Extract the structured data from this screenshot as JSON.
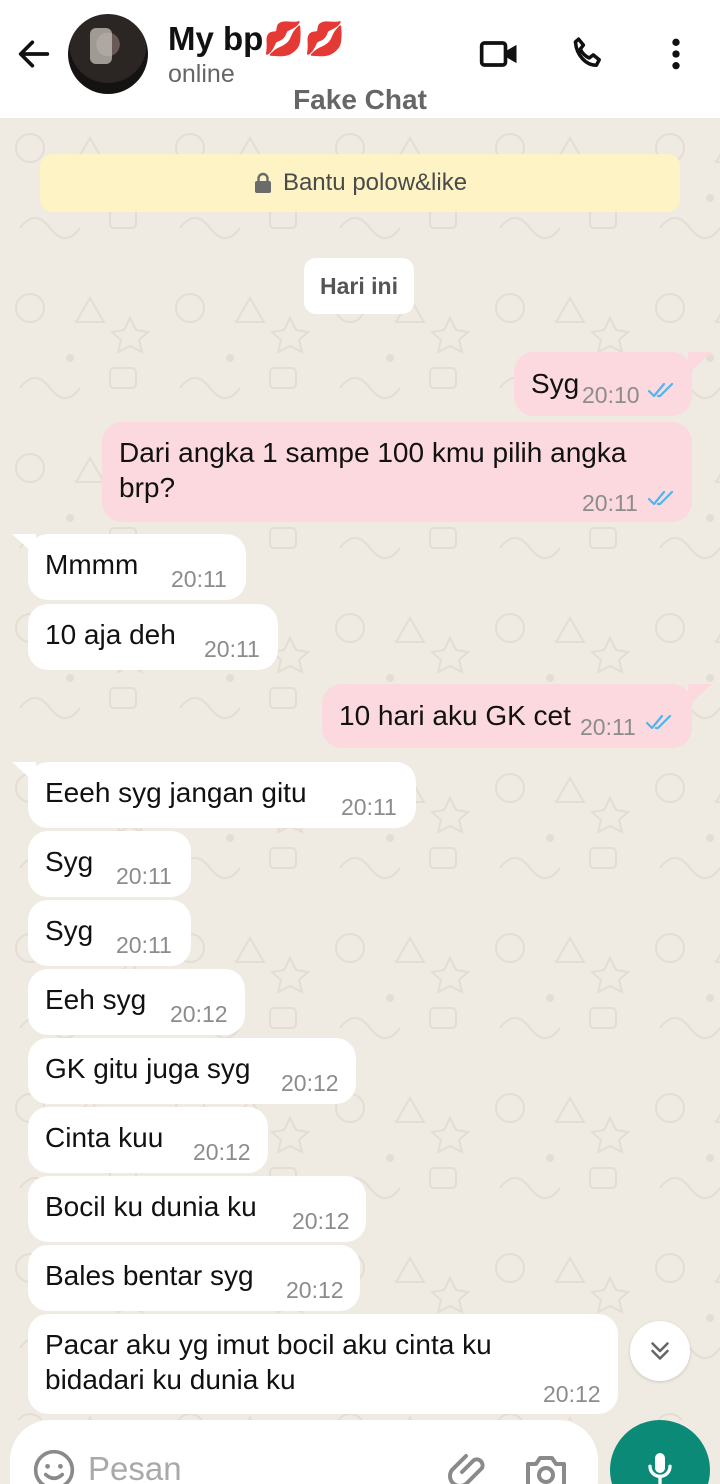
{
  "header": {
    "contact_name": "My bp💋💋",
    "status": "online",
    "title": "Fake Chat"
  },
  "notice": {
    "text": "Bantu polow&like"
  },
  "date_chip": "Hari ini",
  "messages": [
    {
      "dir": "out",
      "text": "Syg",
      "time": "20:10",
      "read": true
    },
    {
      "dir": "out",
      "text": "Dari angka 1 sampe 100 kmu pilih angka brp?",
      "time": "20:11",
      "read": true
    },
    {
      "dir": "in",
      "text": "Mmmm",
      "time": "20:11"
    },
    {
      "dir": "in",
      "text": "10 aja deh",
      "time": "20:11"
    },
    {
      "dir": "out",
      "text": "10 hari aku GK cet",
      "time": "20:11",
      "read": true
    },
    {
      "dir": "in",
      "text": "Eeeh syg jangan gitu",
      "time": "20:11"
    },
    {
      "dir": "in",
      "text": "Syg",
      "time": "20:11"
    },
    {
      "dir": "in",
      "text": "Syg",
      "time": "20:11"
    },
    {
      "dir": "in",
      "text": "Eeh syg",
      "time": "20:12"
    },
    {
      "dir": "in",
      "text": "GK gitu juga syg",
      "time": "20:12"
    },
    {
      "dir": "in",
      "text": "Cinta kuu",
      "time": "20:12"
    },
    {
      "dir": "in",
      "text": "Bocil ku dunia ku",
      "time": "20:12"
    },
    {
      "dir": "in",
      "text": "Bales bentar syg",
      "time": "20:12"
    },
    {
      "dir": "in",
      "text": "Pacar aku yg imut bocil aku cinta ku bidadari ku dunia ku",
      "time": "20:12"
    }
  ],
  "input": {
    "placeholder": "Pesan",
    "value": ""
  },
  "colors": {
    "header_bg": "#ffffff",
    "chat_bg": "#efeae2",
    "incoming_bubble": "#ffffff",
    "outgoing_bubble": "#fbd9de",
    "notice_bg": "#fdf3c4",
    "read_ticks": "#4fb6ec",
    "mic_button": "#0b8a78"
  },
  "icons": {
    "back": "arrow-left-icon",
    "video": "video-camera-icon",
    "call": "phone-icon",
    "menu": "three-dots-vertical-icon",
    "lock": "lock-icon",
    "scroll_down": "double-chevron-down-icon",
    "emoji": "smiley-icon",
    "attach": "paperclip-icon",
    "camera": "camera-icon",
    "mic": "microphone-icon"
  }
}
